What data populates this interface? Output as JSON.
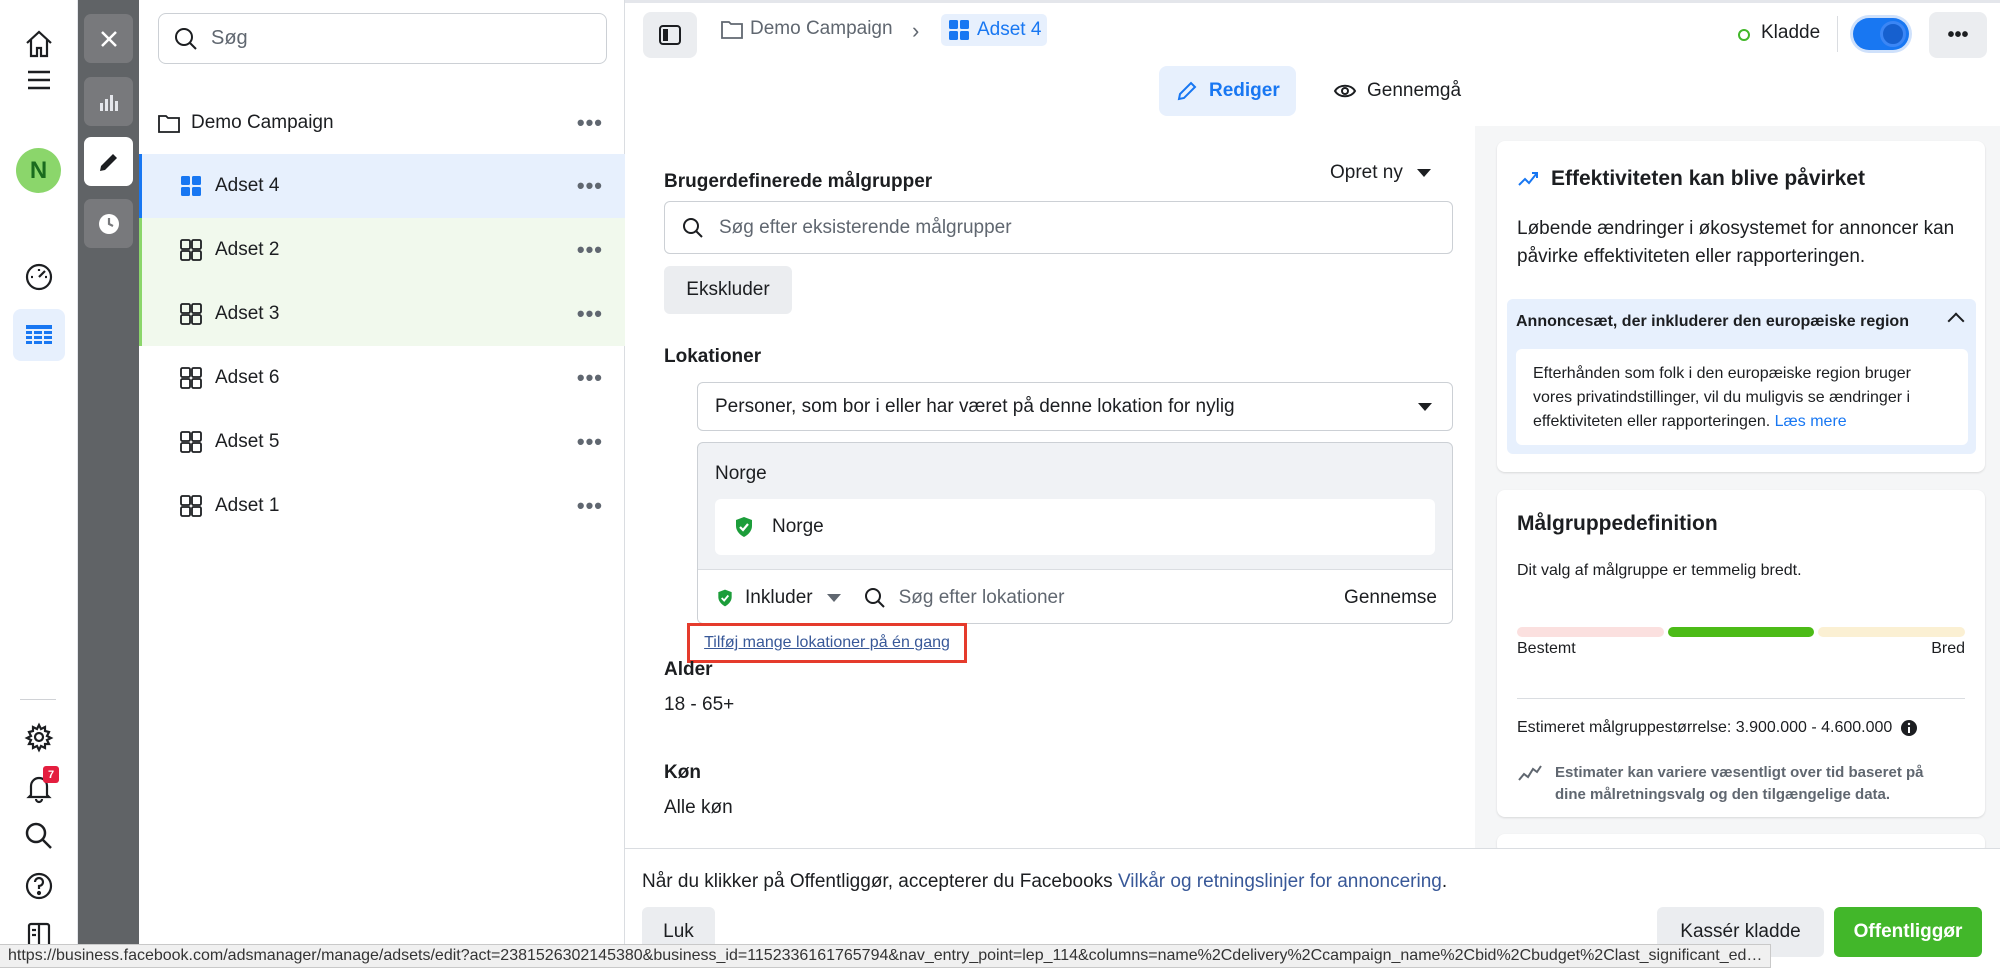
{
  "colors": {
    "accent": "#1877f2",
    "publish_green": "#42b72a",
    "highlight_red": "#e53b2c",
    "meter_active": "#4cbb17"
  },
  "nav_rail": {
    "icons": [
      "home-icon",
      "menu-icon",
      "avatar",
      "dashboard-icon",
      "table-icon",
      "settings-icon",
      "bell-icon",
      "search-icon",
      "help-icon",
      "book-icon"
    ],
    "avatar_letter": "N",
    "notification_count": "7"
  },
  "tool_strip": {
    "icons": [
      "close-icon",
      "chart-icon",
      "pencil-icon",
      "clock-icon"
    ]
  },
  "list_pane": {
    "search_placeholder": "Søg",
    "campaign": "Demo Campaign",
    "more": "•••",
    "adsets": [
      "Adset 4",
      "Adset 2",
      "Adset 3",
      "Adset 6",
      "Adset 5",
      "Adset 1"
    ]
  },
  "header": {
    "breadcrumb": [
      "Demo Campaign",
      "Adset 4"
    ],
    "separator": "›",
    "status": "Kladde",
    "toggle_on": true,
    "more": "•••",
    "tabs": [
      "Rediger",
      "Gennemgå"
    ]
  },
  "form": {
    "custom_audiences_label": "Brugerdefinerede målgrupper",
    "create_new": "Opret ny",
    "audience_search_placeholder": "Søg efter eksisterende målgrupper",
    "exclude_button": "Ekskluder",
    "locations_label": "Lokationer",
    "location_type": "Personer, som bor i eller har været på denne lokation for nylig",
    "country_header": "Norge",
    "country_chip": "Norge",
    "include_label": "Inkluder",
    "location_search_placeholder": "Søg efter lokationer",
    "browse": "Gennemse",
    "add_many_link": "Tilføj mange lokationer på én gang",
    "age_label": "Alder",
    "age_value": "18 - 65+",
    "gender_label": "Køn",
    "gender_value": "Alle køn"
  },
  "footer": {
    "terms_prefix": "Når du klikker på Offentliggør, accepterer du Facebooks ",
    "terms_link": "Vilkår og retningslinjer for annoncering",
    "terms_suffix": ".",
    "close_button": "Luk",
    "discard_button": "Kassér kladde",
    "publish_button": "Offentliggør"
  },
  "performance_card": {
    "title": "Effektiviteten kan blive påvirket",
    "body": "Løbende ændringer i økosystemet for annoncer kan påvirke effektiviteten eller rapporteringen.",
    "notice_title": "Annoncesæt, der inkluderer den europæiske region",
    "notice_body": "Efterhånden som folk i den europæiske region bruger vores privatindstillinger, vil du muligvis se ændringer i effektiviteten eller rapporteringen.",
    "notice_link": "Læs mere"
  },
  "audience_card": {
    "title": "Målgruppedefinition",
    "subtitle": "Dit valg af målgruppe er temmelig bredt.",
    "meter_low": "Bestemt",
    "meter_high": "Bred",
    "meter_active_segment": 2,
    "meter_segments": 3,
    "estimate": "Estimeret målgruppestørrelse: 3.900.000 - 4.600.000",
    "note": "Estimater kan variere væsentligt over tid baseret på dine målretningsvalg og den tilgængelige data."
  },
  "statusbar_url": "https://business.facebook.com/adsmanager/manage/adsets/edit?act=2381526302145380&business_id=1152336161765794&nav_entry_point=lep_114&columns=name%2Cdelivery%2Ccampaign_name%2Cbid%2Cbudget%2Clast_significant_ed…"
}
